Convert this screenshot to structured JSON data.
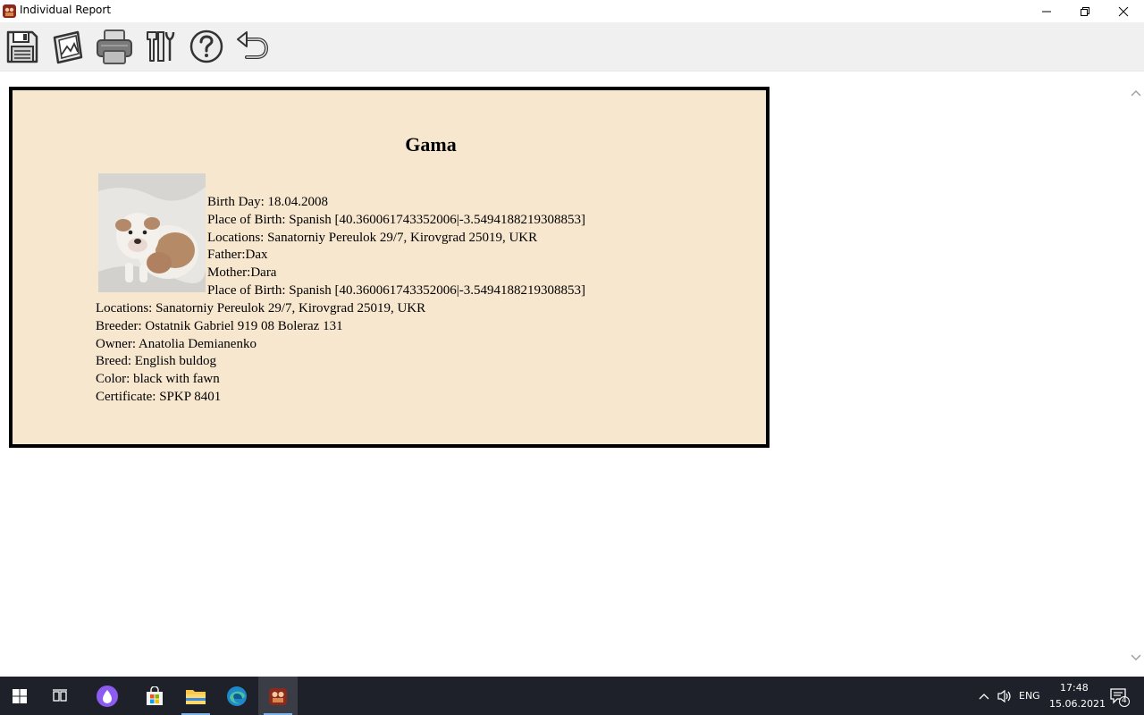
{
  "window": {
    "title": "Individual Report",
    "buttons": [
      "minimize",
      "restore",
      "close"
    ]
  },
  "toolbar": {
    "buttons": [
      {
        "name": "save",
        "icon": "floppy-disk-icon"
      },
      {
        "name": "picture",
        "icon": "picture-icon"
      },
      {
        "name": "print",
        "icon": "printer-icon"
      },
      {
        "name": "settings",
        "icon": "tools-icon"
      },
      {
        "name": "help",
        "icon": "question-icon"
      },
      {
        "name": "back",
        "icon": "undo-arrow-icon"
      }
    ]
  },
  "report": {
    "name": "Gama",
    "photo_alt": "english bulldog puppy",
    "lines_beside_photo": [
      "Birth Day: 18.04.2008",
      "Place of Birth: Spanish [40.360061743352006|-3.5494188219308853]",
      "Locations: Sanatorniy Pereulok 29/7, Kirovgrad 25019, UKR",
      "Father:Dax",
      "Mother:Dara",
      "Place of Birth: Spanish [40.360061743352006|-3.5494188219308853]"
    ],
    "lines_below": [
      "Locations: Sanatorniy Pereulok 29/7, Kirovgrad 25019, UKR",
      "Breeder: Ostatnik Gabriel 919 08 Boleraz 131",
      "Owner: Anatolia Demianenko",
      "Breed: English buldog",
      "Color: black with fawn",
      "Certificate: SPKP 8401"
    ],
    "background_color": "#f8e7cf",
    "border_color": "#000000"
  },
  "taskbar": {
    "items": [
      "start-icon",
      "task-view-icon",
      "alice-icon",
      "store-icon",
      "file-explorer-icon",
      "edge-icon",
      "report-app-icon"
    ],
    "tray": {
      "language": "ENG",
      "time": "17:48",
      "date": "15.06.2021",
      "notifications": "4"
    }
  },
  "colors": {
    "taskbar": "#1e2129",
    "toolbar": "#f0f0f0"
  }
}
